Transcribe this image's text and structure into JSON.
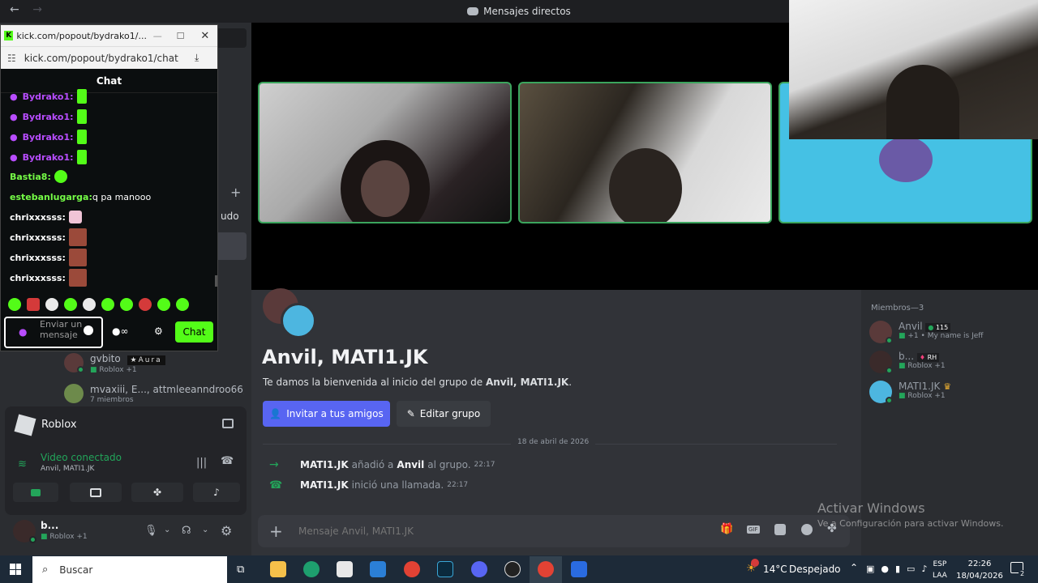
{
  "window": {
    "title": "Mensajes directos"
  },
  "kick": {
    "window_title": "kick.com/popout/bydrako1/...",
    "url": "kick.com/popout/bydrako1/chat",
    "chat_header": "Chat",
    "messages": [
      {
        "user": "Bydrako1:",
        "text": ""
      },
      {
        "user": "Bydrako1:",
        "text": ""
      },
      {
        "user": "Bydrako1:",
        "text": ""
      },
      {
        "user": "Bydrako1:",
        "text": ""
      },
      {
        "user": "Bastia8:",
        "text": ""
      },
      {
        "user": "estebanlugarga:",
        "text": "q pa manooo"
      },
      {
        "user": "chrixxxsss:",
        "text": ""
      },
      {
        "user": "chrixxxsss:",
        "text": ""
      },
      {
        "user": "chrixxxsss:",
        "text": ""
      },
      {
        "user": "chrixxxsss:",
        "text": ""
      }
    ],
    "input_placeholder": "Enviar un mensaje",
    "send_label": "Chat",
    "colors": {
      "accent": "#53fc18",
      "bydrako": "#b84dff",
      "others": "#75fd46"
    }
  },
  "sidebar": {
    "partial_text": "udo",
    "dm_items": [
      {
        "name": "gvbito",
        "badge": "Aura",
        "status": "Roblox +1"
      },
      {
        "name": "mvaxiii, E..., attmleeanndroo66,...",
        "status": "7 miembros"
      }
    ],
    "activity": {
      "title": "Roblox"
    },
    "voice": {
      "status": "Video conectado",
      "channel": "Anvil, MATI1.JK"
    },
    "user": {
      "name": "b...",
      "status": "Roblox +1"
    }
  },
  "main": {
    "group_title": "Anvil, MATI1.JK",
    "welcome_prefix": "Te damos la bienvenida al inicio del grupo de ",
    "welcome_bold": "Anvil, MATI1.JK",
    "welcome_suffix": ".",
    "invite_button": "Invitar a tus amigos",
    "edit_button": "Editar grupo",
    "date_divider": "18 de abril de 2026",
    "events": [
      {
        "actor": "MATI1.JK",
        "action": "añadió a",
        "target": "Anvil",
        "suffix": "al grupo.",
        "time": "22:17"
      },
      {
        "actor": "MATI1.JK",
        "action": "inició una llamada.",
        "target": "",
        "suffix": "",
        "time": "22:17"
      }
    ],
    "composer_placeholder": "Mensaje Anvil, MATI1.JK"
  },
  "members": {
    "header": "Miembros—3",
    "list": [
      {
        "name": "Anvil",
        "tag": "115",
        "sub": "+1 • My name is Jeff"
      },
      {
        "name": "b...",
        "tag": "RH",
        "sub": "Roblox +1"
      },
      {
        "name": "MATI1.JK",
        "tag": "",
        "sub": "Roblox +1"
      }
    ]
  },
  "watermark": {
    "title": "Activar Windows",
    "subtitle": "Ve a Configuración para activar Windows."
  },
  "taskbar": {
    "search": "Buscar",
    "weather_temp": "14°C",
    "weather_desc": "Despejado",
    "lang1": "ESP",
    "lang2": "LAA",
    "time": "22:26",
    "date": "18/04/2026",
    "notif_count": "2"
  }
}
